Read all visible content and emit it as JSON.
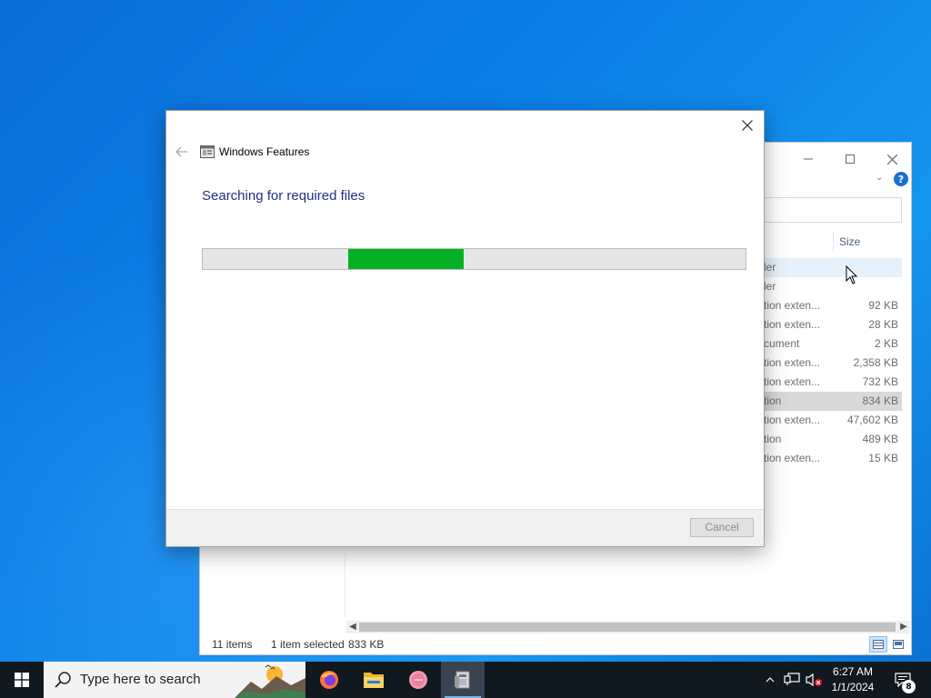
{
  "explorer": {
    "column_size_label": "Size",
    "files": [
      {
        "type": "ler",
        "size": ""
      },
      {
        "type": "ler",
        "size": ""
      },
      {
        "type": "tion exten...",
        "size": "92 KB"
      },
      {
        "type": "tion exten...",
        "size": "28 KB"
      },
      {
        "type": "cument",
        "size": "2 KB"
      },
      {
        "type": "tion exten...",
        "size": "2,358 KB"
      },
      {
        "type": "tion exten...",
        "size": "732 KB"
      },
      {
        "type": "tion",
        "size": "834 KB"
      },
      {
        "type": "tion exten...",
        "size": "47,602 KB"
      },
      {
        "type": "tion",
        "size": "489 KB"
      },
      {
        "type": "tion exten...",
        "size": "15 KB"
      }
    ],
    "status": {
      "item_count": "11 items",
      "selection": "1 item selected",
      "selection_size": "833 KB"
    },
    "help_glyph": "?"
  },
  "dialog": {
    "title": "Windows Features",
    "heading": "Searching for required files",
    "progress_indeterminate": true,
    "cancel_label": "Cancel",
    "cancel_enabled": false
  },
  "taskbar": {
    "search_placeholder": "Type here to search",
    "apps": [
      "firefox-icon",
      "file-explorer-icon",
      "app-icon",
      "windows-features-icon"
    ],
    "clock_time": "6:27 AM",
    "clock_date": "1/1/2024",
    "notification_count": "8"
  },
  "colors": {
    "progress_fill": "#06b025",
    "heading_text": "#1e3287",
    "taskbar_bg": "#101820"
  }
}
